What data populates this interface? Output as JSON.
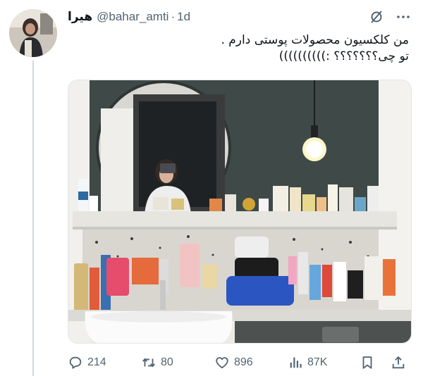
{
  "tweet": {
    "display_name": "هیرا",
    "handle": "@bahar_amti",
    "separator": "·",
    "time": "1d",
    "text": "من کلکسیون محصولات پوستی دارم .\nتو چی؟؟؟؟؟؟؟ :))))))))))",
    "media_description": "photo",
    "icons": {
      "grok": "grok-slash-icon",
      "more": "more-dots-icon",
      "reply": "reply-bubble-icon",
      "retweet": "retweet-icon",
      "like": "heart-icon",
      "views": "views-bar-icon",
      "bookmark": "bookmark-icon",
      "share": "share-icon"
    }
  },
  "actions": {
    "replies": "214",
    "retweets": "80",
    "likes": "896",
    "views": "87K"
  },
  "colors": {
    "text_primary": "#0f1419",
    "text_secondary": "#536471",
    "thread_line": "#cfd9de",
    "wall": "#3f4a48"
  }
}
